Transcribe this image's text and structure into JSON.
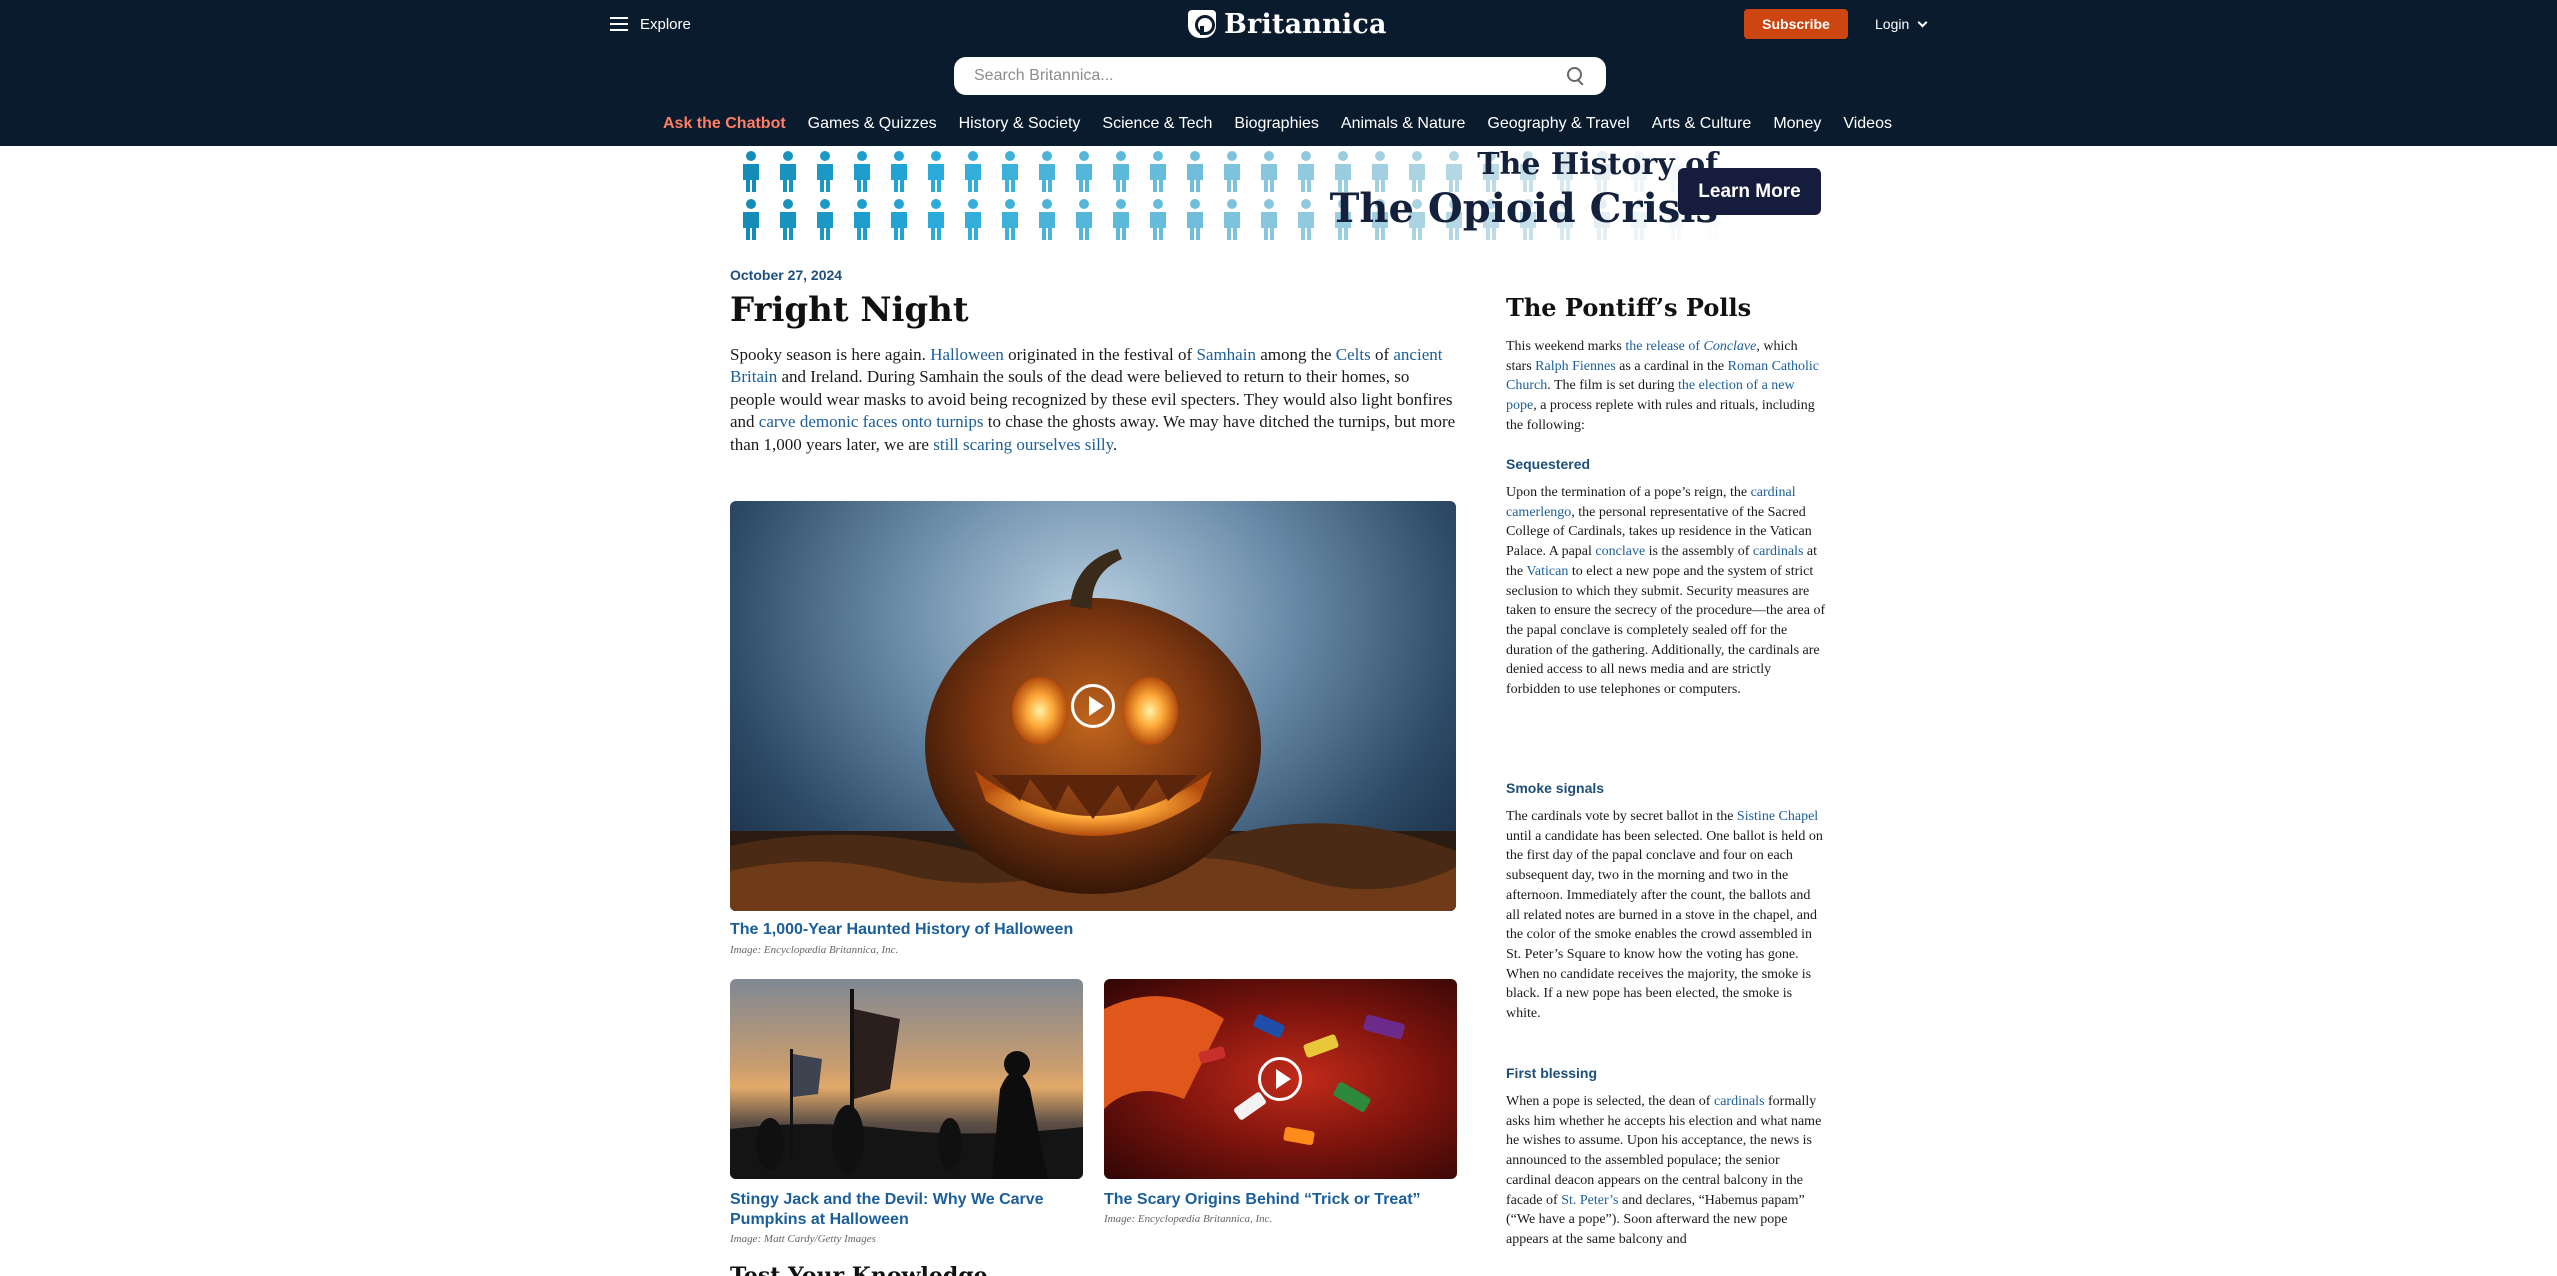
{
  "header": {
    "explore_label": "Explore",
    "logo_text": "Britannica",
    "subscribe_label": "Subscribe",
    "login_label": "Login",
    "search_placeholder": "Search Britannica...",
    "nav": [
      "Ask the Chatbot",
      "Games & Quizzes",
      "History & Society",
      "Science & Tech",
      "Biographies",
      "Animals & Nature",
      "Geography & Travel",
      "Arts & Culture",
      "Money",
      "Videos"
    ]
  },
  "ad": {
    "title_line1": "The History of",
    "title_line2": "The Opioid Crisis",
    "button_label": "Learn More"
  },
  "article": {
    "date": "October 27, 2024",
    "title": "Fright Night",
    "intro": [
      {
        "t": "Spooky season is here again. "
      },
      {
        "t": "Halloween",
        "link": true
      },
      {
        "t": " originated in the festival of "
      },
      {
        "t": "Samhain",
        "link": true
      },
      {
        "t": " among the "
      },
      {
        "t": "Celts",
        "link": true
      },
      {
        "t": " of "
      },
      {
        "t": "ancient Britain",
        "link": true
      },
      {
        "t": " and Ireland. During Samhain the souls of the dead were believed to return to their homes, so people would wear masks to avoid being recognized by these evil specters. They would also light bonfires and "
      },
      {
        "t": "carve demonic faces onto turnips",
        "link": true
      },
      {
        "t": " to chase the ghosts away. We may have ditched the turnips, but more than 1,000 years later, we are "
      },
      {
        "t": "still scaring ourselves silly",
        "link": true
      },
      {
        "t": "."
      }
    ],
    "media": [
      {
        "caption": "The 1,000-Year Haunted History of Halloween",
        "credit": "Image: Encyclopædia Britannica, Inc."
      },
      {
        "caption": "Stingy Jack and the Devil: Why We Carve Pumpkins at Halloween",
        "credit": "Image: Matt Cardy/Getty Images"
      },
      {
        "caption": "The Scary Origins Behind “Trick or Treat”",
        "credit": "Image: Encyclopædia Britannica, Inc."
      }
    ],
    "next_heading": "Test Your Knowledge"
  },
  "sidebar": {
    "title": "The Pontiff’s Polls",
    "intro": [
      {
        "t": "This weekend marks "
      },
      {
        "t": "the release of ",
        "link": true
      },
      {
        "t": "Conclave",
        "link": true,
        "em": true
      },
      {
        "t": ", which stars "
      },
      {
        "t": "Ralph Fiennes",
        "link": true
      },
      {
        "t": " as a cardinal in the "
      },
      {
        "t": "Roman Catholic Church",
        "link": true
      },
      {
        "t": ". The film is set during "
      },
      {
        "t": "the election of a new pope",
        "link": true
      },
      {
        "t": ", a process replete with rules and rituals, including the following:"
      }
    ],
    "sections": [
      {
        "heading": "Sequestered",
        "body": [
          {
            "t": "Upon the termination of a pope’s reign, the "
          },
          {
            "t": "cardinal camerlengo",
            "link": true
          },
          {
            "t": ", the personal representative of the Sacred College of Cardinals, takes up residence in the Vatican Palace. A papal "
          },
          {
            "t": "conclave",
            "link": true
          },
          {
            "t": " is the assembly of "
          },
          {
            "t": "cardinals",
            "link": true
          },
          {
            "t": " at the "
          },
          {
            "t": "Vatican",
            "link": true
          },
          {
            "t": " to elect a new pope and the system of strict seclusion to which they submit. Security measures are taken to ensure the secrecy of the procedure—the area of the papal conclave is completely sealed off for the duration of the gathering. Additionally, the cardinals are denied access to all news media and are strictly forbidden to use telephones or computers."
          }
        ]
      },
      {
        "heading": "Smoke signals",
        "body": [
          {
            "t": "The cardinals vote by secret ballot in the "
          },
          {
            "t": "Sistine Chapel",
            "link": true
          },
          {
            "t": " until a candidate has been selected. One ballot is held on the first day of the papal conclave and four on each subsequent day, two in the morning and two in the afternoon. Immediately after the count, the ballots and all related notes are burned in a stove in the chapel, and the color of the smoke enables the crowd assembled in St. Peter’s Square to know how the voting has gone. When no candidate receives the majority, the smoke is black. If a new pope has been elected, the smoke is white."
          }
        ]
      },
      {
        "heading": "First blessing",
        "body": [
          {
            "t": "When a pope is selected, the dean of "
          },
          {
            "t": "cardinals",
            "link": true
          },
          {
            "t": " formally asks him whether he accepts his election and what name he wishes to assume. Upon his acceptance, the news is announced to the assembled populace; the senior cardinal deacon appears on the central balcony in the facade of "
          },
          {
            "t": "St. Peter’s",
            "link": true
          },
          {
            "t": " and declares, “Habemus papam” (“We have a pope”). Soon afterward the new pope appears at the same balcony and"
          }
        ]
      }
    ]
  },
  "colors": {
    "header_bg": "#0a1b2e",
    "subscribe_bg": "#cd4510",
    "chatbot_accent": "#ff7e64",
    "link": "#1a5e9a",
    "ad_button_bg": "#161d3c"
  },
  "icons": [
    "menu-icon",
    "britannica-thistle-icon",
    "chevron-down-icon",
    "search-icon",
    "play-icon",
    "person-icon"
  ]
}
